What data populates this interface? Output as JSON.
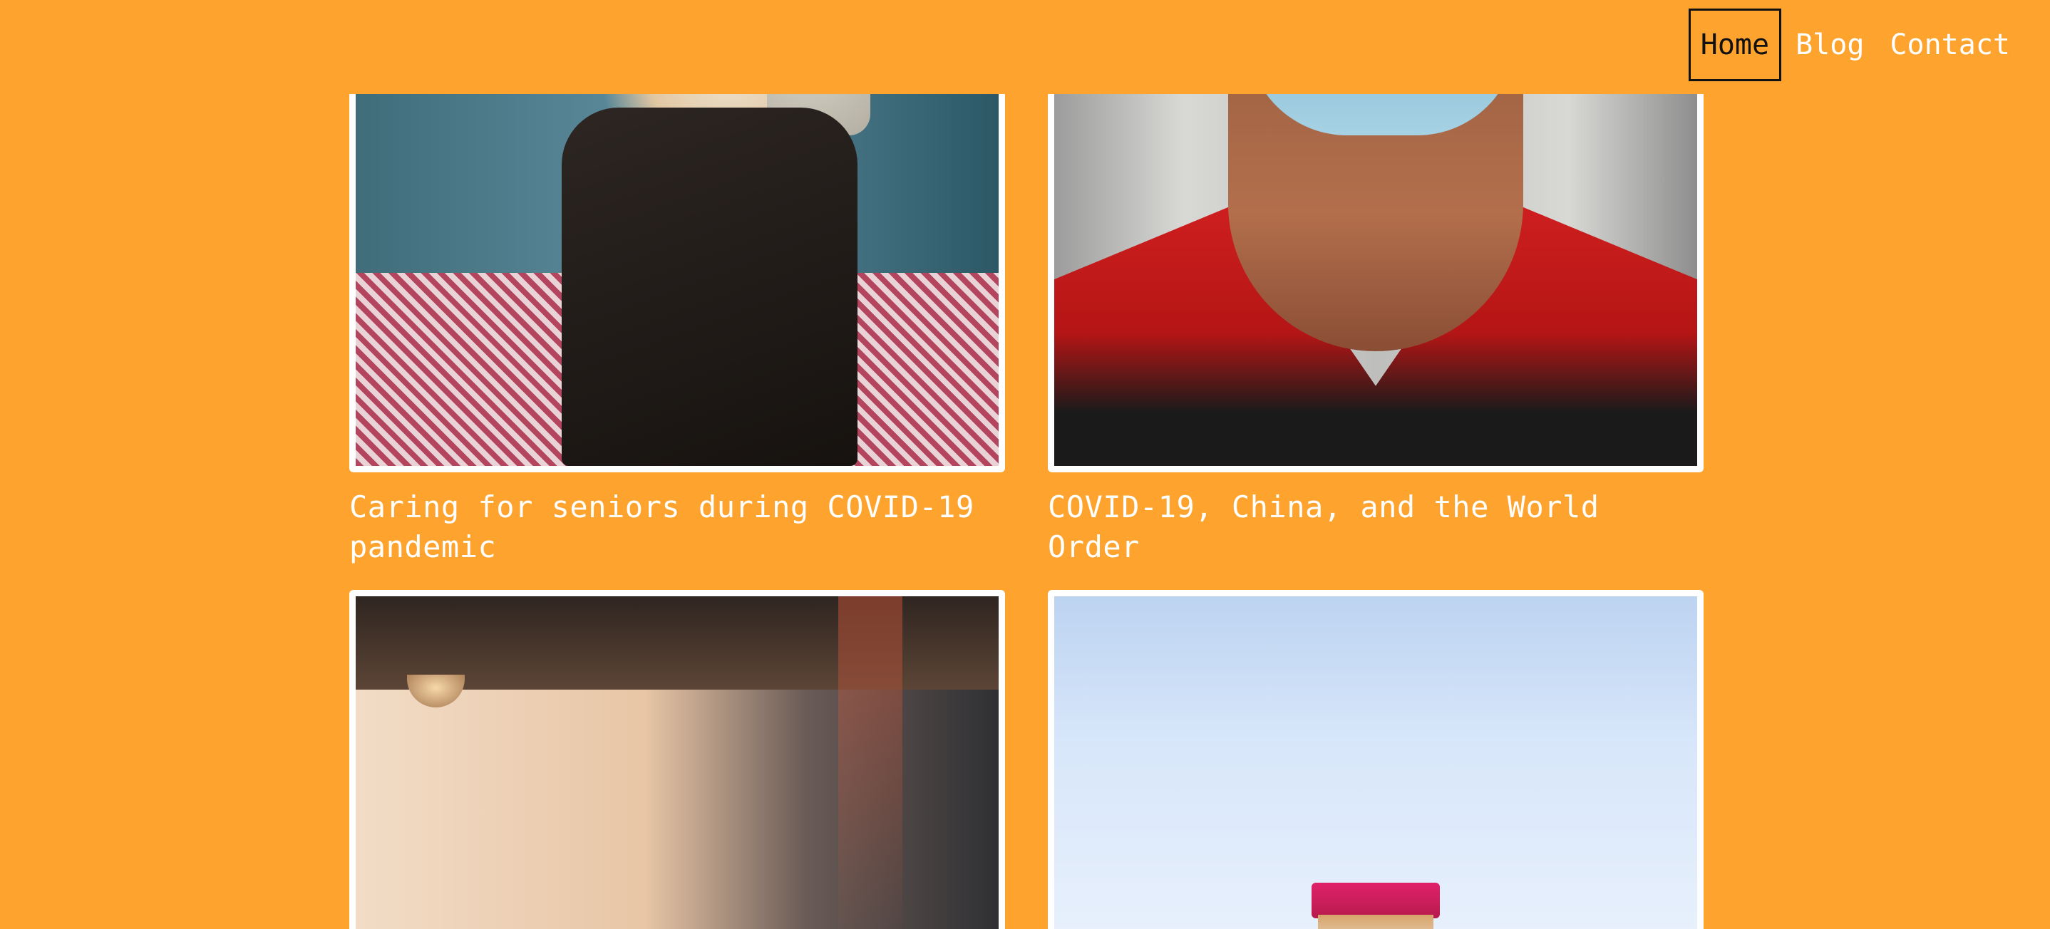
{
  "nav": {
    "items": [
      {
        "label": "Home",
        "active": true
      },
      {
        "label": "Blog",
        "active": false
      },
      {
        "label": "Contact",
        "active": false
      }
    ]
  },
  "posts": [
    {
      "title": "Caring for seniors during COVID-19 pandemic",
      "image": "senior-on-couch-photo"
    },
    {
      "title": "COVID-19, China, and the World Order",
      "image": "masked-man-photo"
    },
    {
      "title": "",
      "image": "sunlit-wall-photo"
    },
    {
      "title": "",
      "image": "vaccine-vial-photo"
    }
  ],
  "colors": {
    "background": "#FEA42E",
    "text": "#FFFFFF",
    "active_nav_text": "#111111"
  }
}
